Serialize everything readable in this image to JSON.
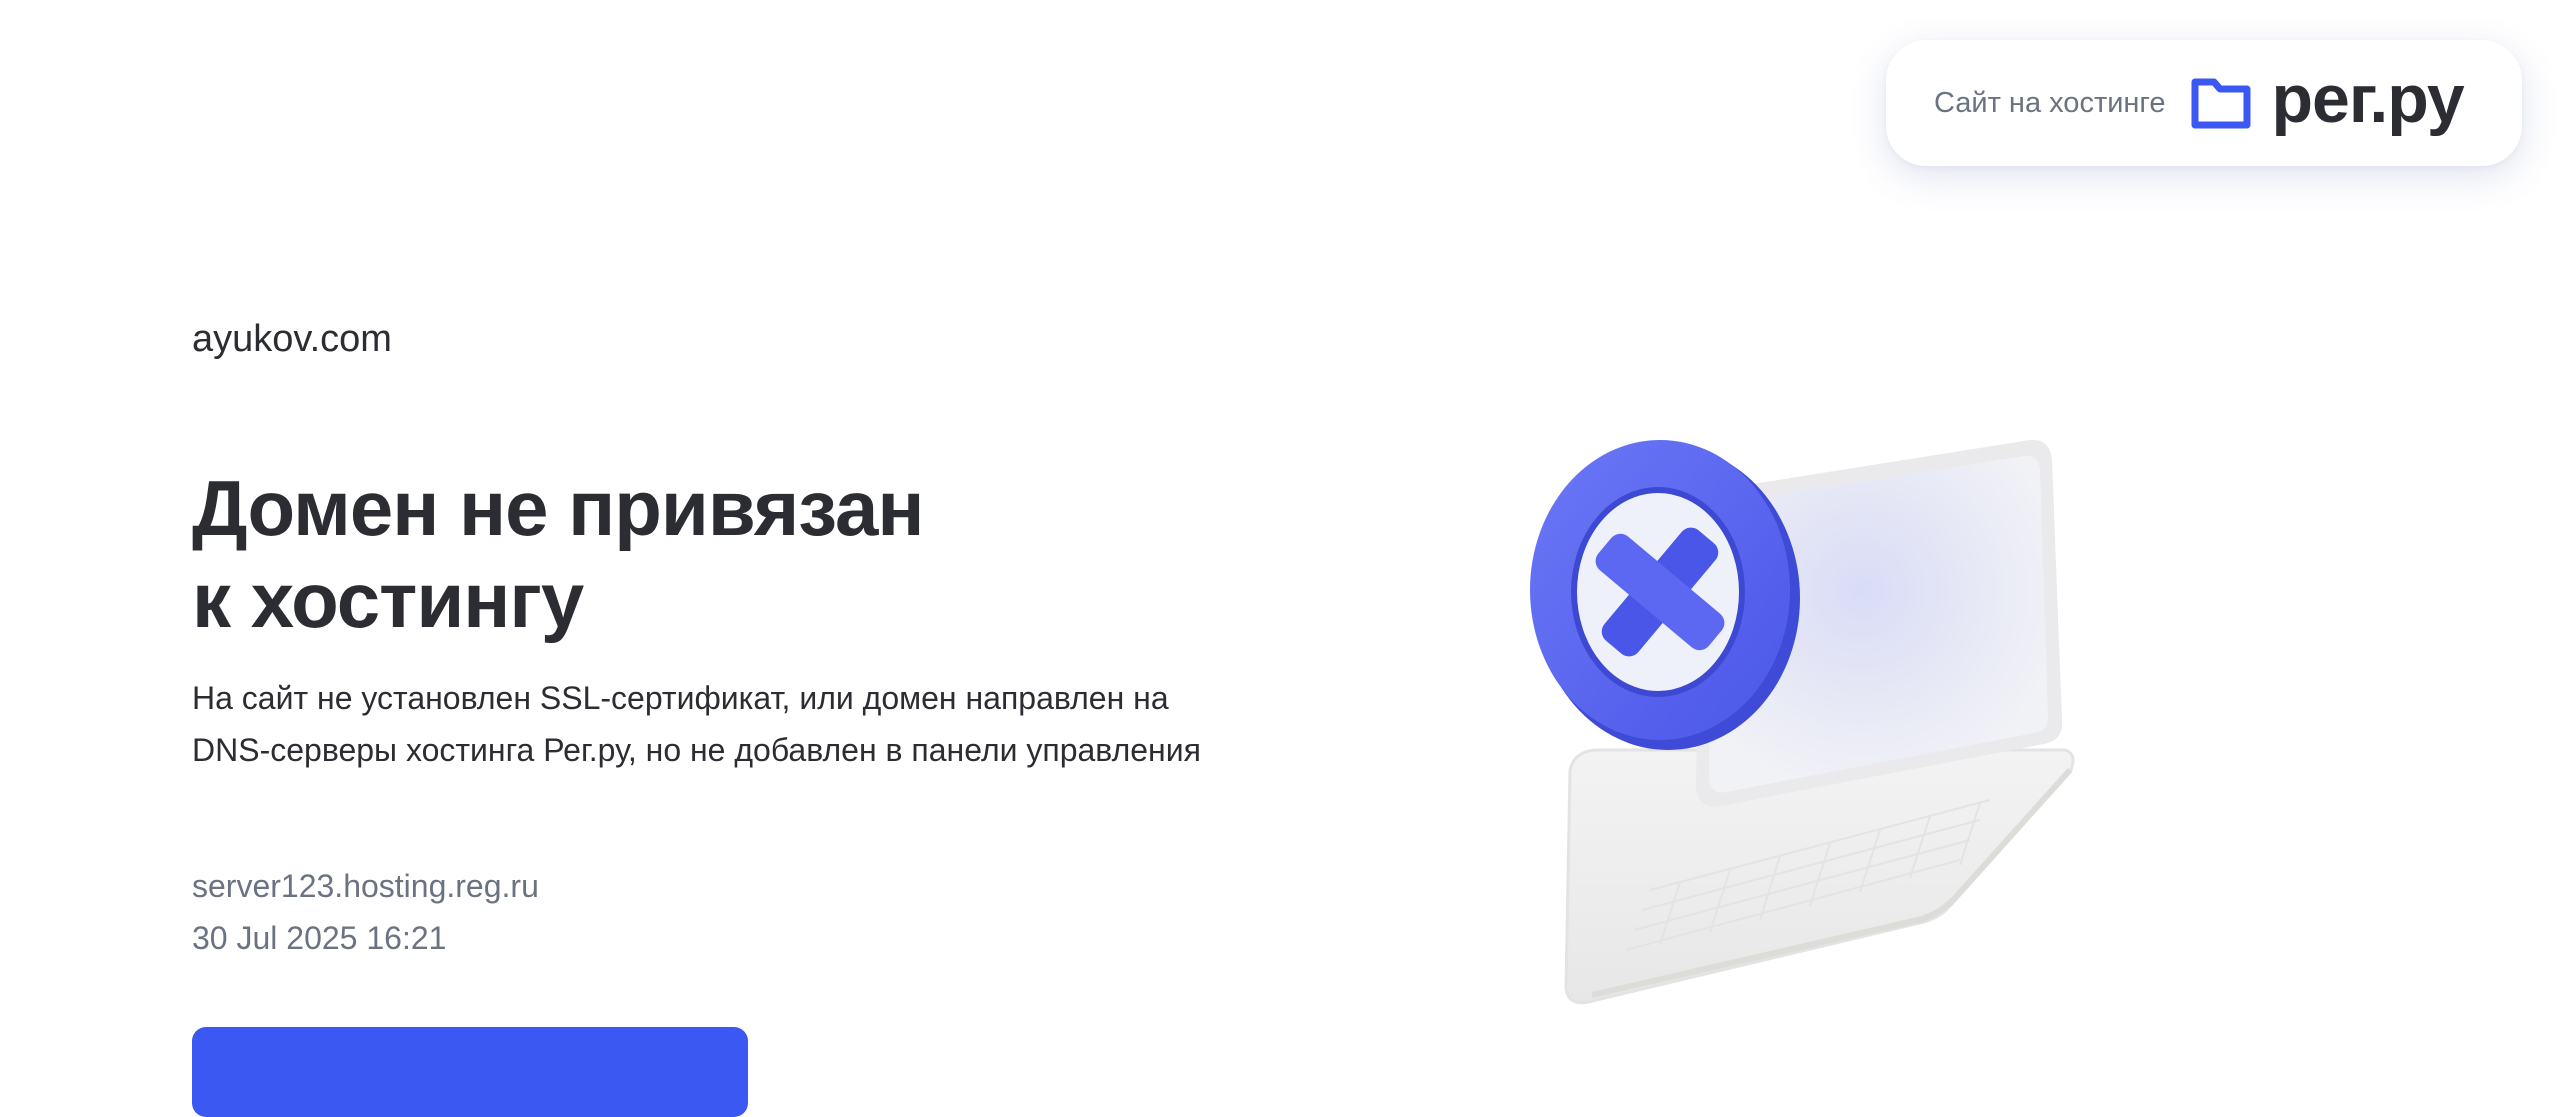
{
  "header": {
    "host_label": "Сайт на хостинге",
    "logo_text": "рег.ру",
    "logo_icon": "folder-icon",
    "brand_color": "#3c58f2"
  },
  "main": {
    "domain": "ayukov.com",
    "title_line1": "Домен не привязан",
    "title_line2": "к хостингу",
    "description": "На сайт не установлен SSL-сертификат, или домен направлен на DNS-серверы хостинга Рег.ру, но не добавлен в панели управления",
    "server": "server123.hosting.reg.ru",
    "timestamp": "30 Jul 2025 16:21"
  },
  "illustration": {
    "icon": "laptop-error-icon",
    "accent_color": "#5a66f0"
  }
}
